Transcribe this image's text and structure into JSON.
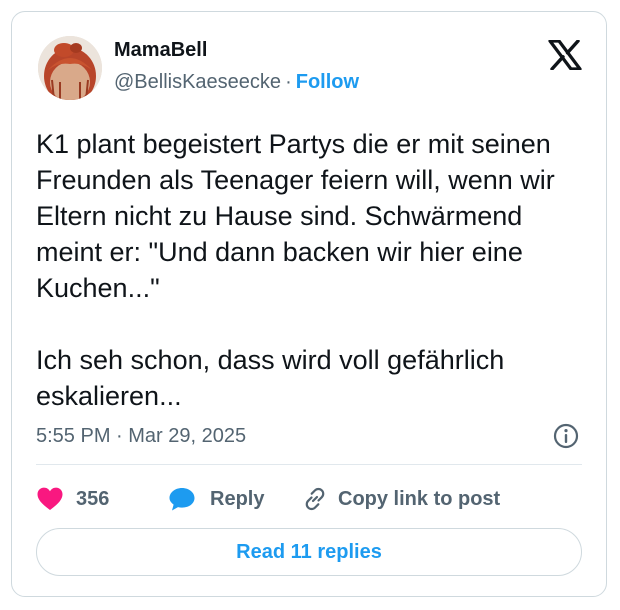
{
  "author": {
    "display_name": "MamaBell",
    "handle": "@BellisKaeseecke",
    "follow_label": "Follow",
    "separator": "·"
  },
  "tweet": {
    "paragraphs": [
      "K1 plant begeistert Partys die er mit seinen Freunden als Teenager feiern will, wenn wir Eltern nicht zu Hause sind. Schwärmend meint er: \"Und dann backen wir hier eine Kuchen...\"",
      "Ich seh schon, dass wird voll gefährlich eskalieren..."
    ],
    "timestamp": "5:55 PM · Mar 29, 2025"
  },
  "actions": {
    "like_count": "356",
    "reply_label": "Reply",
    "copy_label": "Copy link to post"
  },
  "read_replies_label": "Read 11 replies",
  "icons": {
    "logo": "x-logo-icon",
    "info": "info-icon",
    "like": "heart-icon",
    "reply": "speech-bubble-icon",
    "copy": "link-icon"
  },
  "colors": {
    "accent": "#1d9bf0",
    "like": "#f91880",
    "secondary_text": "#536471",
    "border": "#cfd9de"
  }
}
